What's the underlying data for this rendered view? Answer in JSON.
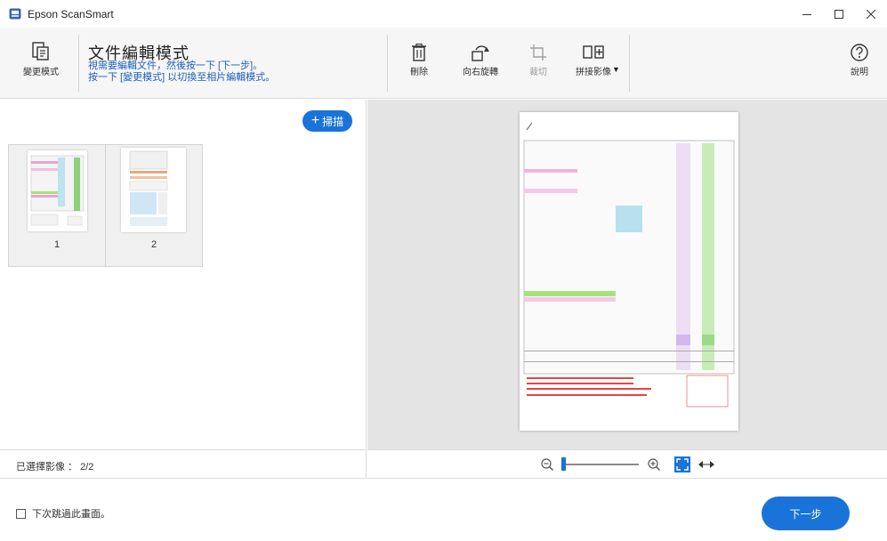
{
  "window": {
    "title": "Epson ScanSmart"
  },
  "toolbar": {
    "change_mode": "變更模式",
    "mode_title": "文件編輯模式",
    "mode_desc_line1": "視需要編輯文件，然後按一下 [下一步]。",
    "mode_desc_line2": "按一下 [變更模式] 以切換至相片編輯模式。",
    "delete": "刪除",
    "rotate_right": "向右旋轉",
    "crop": "裁切",
    "stitch": "拼接影像",
    "help": "說明"
  },
  "left_panel": {
    "scan_button": "掃描",
    "thumbnails": [
      {
        "number": "1"
      },
      {
        "number": "2"
      }
    ],
    "selected_images": "已選擇影像 ： 2/2"
  },
  "footer": {
    "skip_checkbox_label": "下次跳過此畫面。",
    "skip_checked": false,
    "next_button": "下一步"
  },
  "colors": {
    "accent": "#1a73d8",
    "mode_desc": "#1f5fb8",
    "preview_bg": "#e4e4e4"
  }
}
